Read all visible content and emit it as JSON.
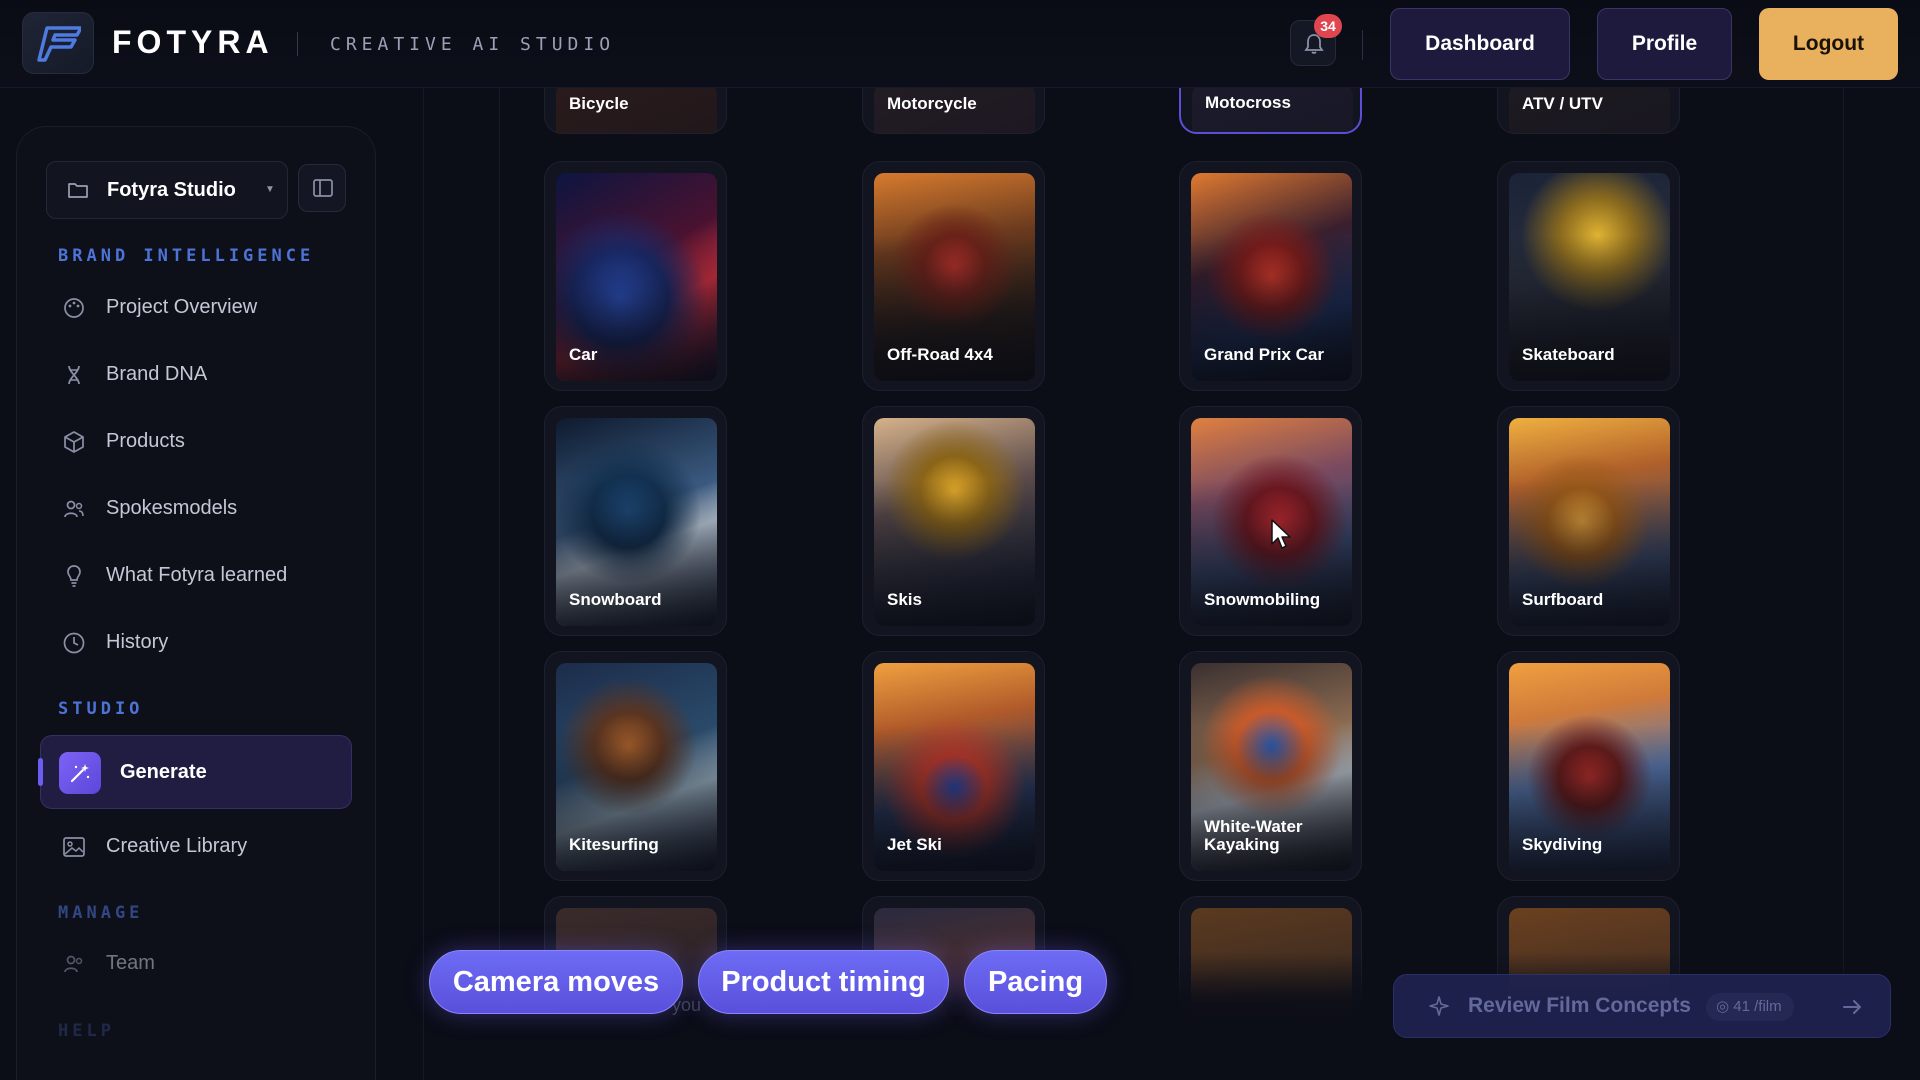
{
  "header": {
    "brand": "FOTYRA",
    "tagline": "CREATIVE AI STUDIO",
    "notification_count": "34",
    "dashboard_label": "Dashboard",
    "profile_label": "Profile",
    "logout_label": "Logout"
  },
  "sidebar": {
    "workspace_name": "Fotyra Studio",
    "sections": {
      "brand_intelligence": "BRAND INTELLIGENCE",
      "studio": "STUDIO",
      "manage": "MANAGE",
      "help": "HELP"
    },
    "brand_items": [
      {
        "label": "Project Overview",
        "icon": "palette-icon"
      },
      {
        "label": "Brand DNA",
        "icon": "dna-icon"
      },
      {
        "label": "Products",
        "icon": "cube-icon"
      },
      {
        "label": "Spokesmodels",
        "icon": "users-icon"
      },
      {
        "label": "What Fotyra learned",
        "icon": "lightbulb-icon"
      },
      {
        "label": "History",
        "icon": "clock-icon"
      }
    ],
    "studio_items": [
      {
        "label": "Generate",
        "icon": "magic-wand-icon",
        "active": true
      },
      {
        "label": "Creative Library",
        "icon": "image-icon"
      }
    ],
    "manage_items": [
      {
        "label": "Team",
        "icon": "users-icon"
      }
    ]
  },
  "activities": {
    "top_row": [
      "Bicycle",
      "Motorcycle",
      "Motocross",
      "ATV / UTV"
    ],
    "rows": [
      [
        "Car",
        "Off-Road 4x4",
        "Grand Prix Car",
        "Skateboard"
      ],
      [
        "Snowboard",
        "Skis",
        "Snowmobiling",
        "Surfboard"
      ],
      [
        "Kitesurfing",
        "Jet Ski",
        "White-Water Kayaking",
        "Skydiving"
      ]
    ],
    "selected": "Motocross"
  },
  "chips": [
    "Camera moves",
    "Product timing",
    "Pacing"
  ],
  "hint_text": "you",
  "review": {
    "label": "Review Film Concepts",
    "cost": "41",
    "cost_unit": "/film"
  },
  "colors": {
    "accent": "#6d5cf0",
    "logout_bg": "#e9b05d",
    "badge": "#e0464f",
    "section_label": "#4e73d8"
  }
}
